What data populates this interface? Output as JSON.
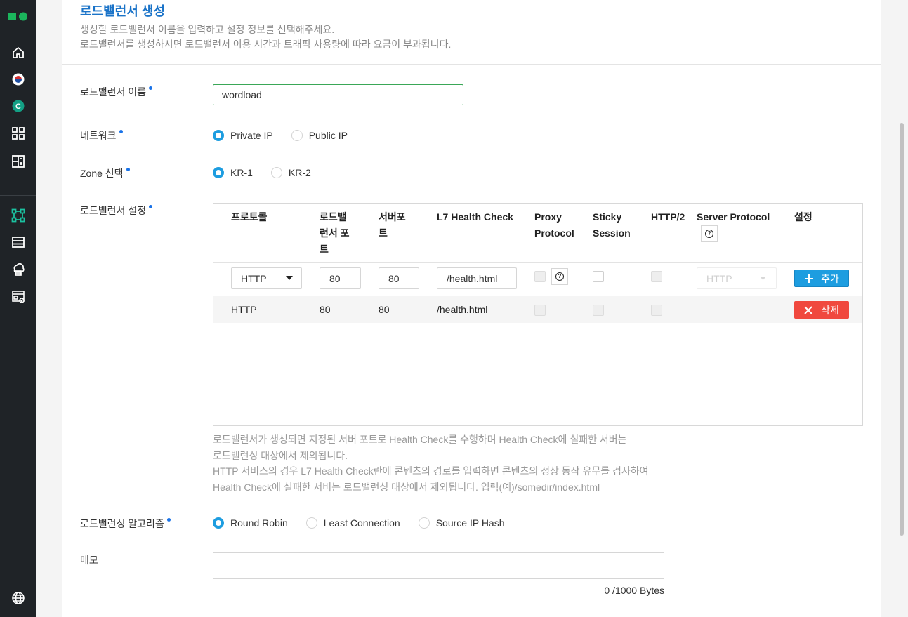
{
  "sidebar": {
    "icons": [
      "logo-icon",
      "home-icon",
      "korea-flag-icon",
      "c-badge-icon",
      "grid-icon",
      "dashboard-icon",
      "network-icon",
      "list-icon",
      "cloud-storage-icon",
      "report-icon",
      "globe-icon"
    ],
    "c_badge": "C"
  },
  "header": {
    "title": "로드밸런서 생성",
    "desc1": "생성할 로드밸런서 이름을 입력하고 설정 정보를 선택해주세요.",
    "desc2": "로드밸런서를 생성하시면 로드밸런서 이용 시간과 트래픽 사용량에 따라 요금이 부과됩니다."
  },
  "form": {
    "name_label": "로드밸런서 이름",
    "name_value": "wordload",
    "network_label": "네트워크",
    "network_options": [
      "Private IP",
      "Public IP"
    ],
    "zone_label": "Zone 선택",
    "zone_options": [
      "KR-1",
      "KR-2"
    ],
    "lb_settings_label": "로드밸런서 설정",
    "algo_label": "로드밸런싱 알고리즘",
    "algo_options": [
      "Round Robin",
      "Least Connection",
      "Source IP Hash"
    ],
    "memo_label": "메모",
    "memo_count": "0 /1000 Bytes"
  },
  "table": {
    "headers": {
      "protocol": "프로토콜",
      "lb_port_1": "로드밸",
      "lb_port_2": "런서 포",
      "lb_port_3": "트",
      "server_port_1": "서버포",
      "server_port_2": "트",
      "health": "L7 Health Check",
      "proxy_1": "Proxy",
      "proxy_2": "Protocol",
      "sticky_1": "Sticky",
      "sticky_2": "Session",
      "http2": "HTTP/2",
      "server_protocol": "Server Protocol",
      "settings": "설정"
    },
    "input_row": {
      "protocol": "HTTP",
      "lb_port": "80",
      "server_port": "80",
      "health": "/health.html",
      "server_protocol": "HTTP",
      "add_label": "추가",
      "help": "?"
    },
    "rows": [
      {
        "protocol": "HTTP",
        "lb_port": "80",
        "server_port": "80",
        "health": "/health.html",
        "delete_label": "삭제"
      }
    ]
  },
  "notes": [
    "로드밸런서가 생성되면 지정된 서버 포트로 Health Check를 수행하며 Health Check에 실패한 서버는",
    "로드밸런싱 대상에서 제외됩니다.",
    "HTTP 서비스의 경우 L7 Health Check란에 콘텐츠의 경로를 입력하면 콘텐츠의 정상 동작 유무를 검사하여",
    "Health Check에 실패한 서버는 로드밸런싱 대상에서 제외됩니다. 입력(예)/somedir/index.html"
  ],
  "colors": {
    "accent": "#1d9de0",
    "title": "#1a73c8",
    "danger": "#f0483e",
    "sidebar": "#1f2327",
    "valid_border": "#3aa757"
  }
}
